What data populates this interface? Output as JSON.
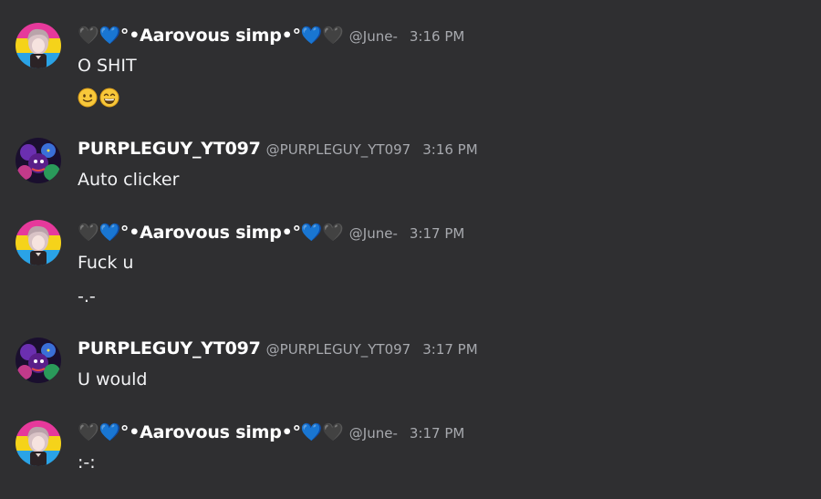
{
  "users": {
    "aarovous": {
      "display_name": "🖤💙°•Aarovous simp•°💙🖤",
      "handle": "@June-"
    },
    "purpleguy": {
      "display_name": "PURPLEGUY_YT097",
      "handle": "@PURPLEGUY_YT097"
    }
  },
  "messages": [
    {
      "time": "3:16 PM",
      "lines": [
        "O SHIT"
      ],
      "emojis": [
        "slightly-smiling-face",
        "grinning-face"
      ]
    },
    {
      "time": "3:16 PM",
      "lines": [
        "Auto clicker"
      ]
    },
    {
      "time": "3:17 PM",
      "lines": [
        "Fuck u",
        "-.-"
      ]
    },
    {
      "time": "3:17 PM",
      "lines": [
        "U would"
      ]
    },
    {
      "time": "3:17 PM",
      "lines": [
        ":-:"
      ]
    }
  ],
  "colors": {
    "background": "#2f2f31",
    "text": "#f2f3f5",
    "muted": "#a7a9ae",
    "heart_blue": "#29a8e8"
  }
}
